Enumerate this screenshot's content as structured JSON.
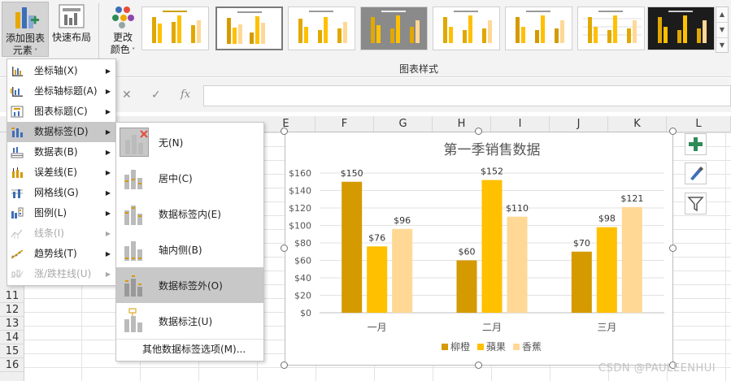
{
  "ribbon": {
    "add_element_line1": "添加图表",
    "add_element_line2": "元素",
    "quick_layout": "快速布局",
    "change_color_line1": "更改",
    "change_color_line2": "颜色",
    "group_label": "图表样式"
  },
  "columns": [
    "E",
    "F",
    "G",
    "H",
    "I",
    "J",
    "K",
    "L"
  ],
  "rows": [
    "11",
    "12",
    "13",
    "14",
    "15",
    "16"
  ],
  "formula_bar": {
    "cancel": "✕",
    "confirm": "✓",
    "fx": "fx"
  },
  "menu_main": [
    {
      "label": "坐标轴(X)",
      "icon": "axis-icon",
      "arrow": "▶",
      "disabled": false
    },
    {
      "label": "坐标轴标题(A)",
      "icon": "axis-title-icon",
      "arrow": "▶",
      "disabled": false
    },
    {
      "label": "图表标题(C)",
      "icon": "chart-title-icon",
      "arrow": "▶",
      "disabled": false
    },
    {
      "label": "数据标签(D)",
      "icon": "data-labels-icon",
      "arrow": "▶",
      "disabled": false
    },
    {
      "label": "数据表(B)",
      "icon": "data-table-icon",
      "arrow": "▶",
      "disabled": false
    },
    {
      "label": "误差线(E)",
      "icon": "error-bars-icon",
      "arrow": "▶",
      "disabled": false
    },
    {
      "label": "网格线(G)",
      "icon": "gridlines-icon",
      "arrow": "▶",
      "disabled": false
    },
    {
      "label": "图例(L)",
      "icon": "legend-icon",
      "arrow": "▶",
      "disabled": false
    },
    {
      "label": "线条(I)",
      "icon": "lines-icon",
      "arrow": "▶",
      "disabled": true
    },
    {
      "label": "趋势线(T)",
      "icon": "trendline-icon",
      "arrow": "▶",
      "disabled": false
    },
    {
      "label": "涨/跌柱线(U)",
      "icon": "up-down-bars-icon",
      "arrow": "▶",
      "disabled": true
    }
  ],
  "menu_sub": [
    {
      "label": "无(N)",
      "icon": "none-icon"
    },
    {
      "label": "居中(C)",
      "icon": "center-icon"
    },
    {
      "label": "数据标签内(E)",
      "icon": "inside-end-icon"
    },
    {
      "label": "轴内侧(B)",
      "icon": "inside-base-icon"
    },
    {
      "label": "数据标签外(O)",
      "icon": "outside-end-icon"
    },
    {
      "label": "数据标注(U)",
      "icon": "data-callout-icon"
    }
  ],
  "menu_sub_more": "其他数据标签选项(M)...",
  "side_buttons": {
    "add": "plus-icon",
    "style": "brush-icon",
    "filter": "filter-icon"
  },
  "colors": {
    "orange": "#D59A00",
    "yellow": "#FFC000",
    "banana": "#FFD896"
  },
  "chart_data": {
    "type": "bar",
    "title": "第一季销售数据",
    "categories": [
      "一月",
      "二月",
      "三月"
    ],
    "series": [
      {
        "name": "柳橙",
        "values": [
          150,
          60,
          70
        ],
        "labels": [
          "$150",
          "$60",
          "$70"
        ],
        "color": "#D59A00"
      },
      {
        "name": "蘋果",
        "values": [
          76,
          152,
          98
        ],
        "labels": [
          "$76",
          "$152",
          "$98"
        ],
        "color": "#FFC000"
      },
      {
        "name": "香蕉",
        "values": [
          96,
          110,
          121
        ],
        "labels": [
          "$96",
          "$110",
          "$121"
        ],
        "color": "#FFD896"
      }
    ],
    "ylim": [
      0,
      160
    ],
    "yticks": [
      "$0",
      "$20",
      "$40",
      "$60",
      "$80",
      "$100",
      "$120",
      "$140",
      "$160"
    ],
    "grid": true,
    "legend_position": "bottom"
  },
  "watermark": "CSDN @PAULEENHUI"
}
